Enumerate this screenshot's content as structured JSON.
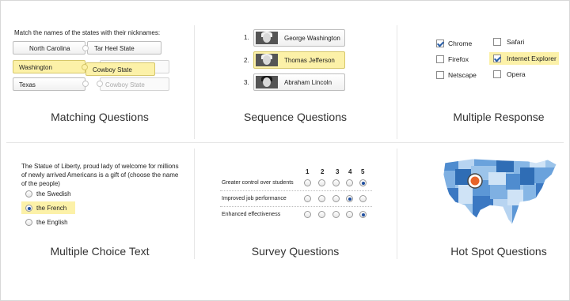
{
  "matching": {
    "prompt": "Match the names of the states with their nicknames:",
    "left": [
      "North Carolina",
      "Washington",
      "Texas"
    ],
    "right": [
      "Tar Heel State",
      "Cowboy State",
      "Cowboy State"
    ],
    "title": "Matching Questions"
  },
  "sequence": {
    "items": [
      {
        "num": "1.",
        "name": "George Washington"
      },
      {
        "num": "2.",
        "name": "Thomas Jefferson"
      },
      {
        "num": "3.",
        "name": "Abraham Lincoln"
      }
    ],
    "title": "Sequence Questions"
  },
  "multiple_response": {
    "options": [
      {
        "label": "Chrome",
        "checked": true
      },
      {
        "label": "Safari",
        "checked": false
      },
      {
        "label": "Firefox",
        "checked": false
      },
      {
        "label": "Internet Explorer",
        "checked": true
      },
      {
        "label": "Netscape",
        "checked": false
      },
      {
        "label": "Opera",
        "checked": false
      }
    ],
    "title": "Multiple Response"
  },
  "multiple_choice": {
    "question": "The Statue of Liberty, proud lady of welcome for millions of newly arrived Americans is a gift of (choose the name of the people)",
    "q1": "The Statue of Liberty, proud lady of welcome for millions",
    "q2": "of newly arrived Americans is a gift of (choose the name",
    "q3": "of the people)",
    "options": [
      "the Swedish",
      "the French",
      "the English"
    ],
    "title": "Multiple Choice Text"
  },
  "survey": {
    "scale": [
      "1",
      "2",
      "3",
      "4",
      "5"
    ],
    "rows": [
      {
        "label": "Greater control over students",
        "selected": 5
      },
      {
        "label": "Improved job performance",
        "selected": 4
      },
      {
        "label": "Enhanced effectiveness",
        "selected": 5
      }
    ],
    "title": "Survey Questions"
  },
  "hotspot": {
    "title": "Hot Spot Questions"
  },
  "colors": {
    "highlight": "#fcf1a8",
    "radio_selected": "#1f4fa0",
    "map_dark": "#2f6db5",
    "map_light": "#cfe3f6",
    "hotspot": "#e8642a"
  }
}
